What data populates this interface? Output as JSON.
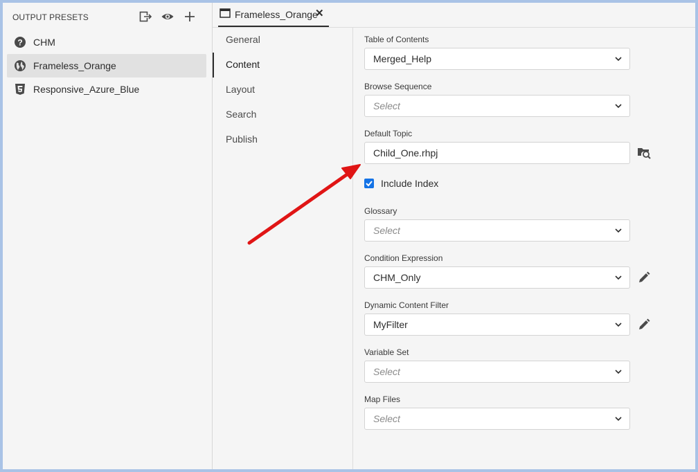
{
  "left_panel": {
    "title": "OUTPUT PRESETS",
    "header_icons": [
      "export-icon",
      "eye-icon",
      "plus-icon"
    ],
    "presets": [
      {
        "label": "CHM",
        "icon": "help-circle-icon",
        "selected": false
      },
      {
        "label": "Frameless_Orange",
        "icon": "globe-icon",
        "selected": true
      },
      {
        "label": "Responsive_Azure_Blue",
        "icon": "html5-icon",
        "selected": false
      }
    ]
  },
  "tab": {
    "label": "Frameless_Orange",
    "close": "✕"
  },
  "nav": {
    "items": [
      "General",
      "Content",
      "Layout",
      "Search",
      "Publish"
    ],
    "active": "Content"
  },
  "fields": {
    "toc": {
      "label": "Table of Contents",
      "value": "Merged_Help"
    },
    "browse": {
      "label": "Browse Sequence",
      "placeholder": "Select"
    },
    "default_topic": {
      "label": "Default Topic",
      "value": "Child_One.rhpj"
    },
    "include_index": {
      "label": "Include Index",
      "checked": true
    },
    "glossary": {
      "label": "Glossary",
      "placeholder": "Select"
    },
    "condition": {
      "label": "Condition Expression",
      "value": "CHM_Only"
    },
    "dcf": {
      "label": "Dynamic Content Filter",
      "value": "MyFilter"
    },
    "variable_set": {
      "label": "Variable Set",
      "placeholder": "Select"
    },
    "map_files": {
      "label": "Map Files",
      "placeholder": "Select"
    }
  },
  "colors": {
    "accent": "#1473e6",
    "annotation_arrow": "#e01515",
    "frame": "#a9c3e6"
  }
}
